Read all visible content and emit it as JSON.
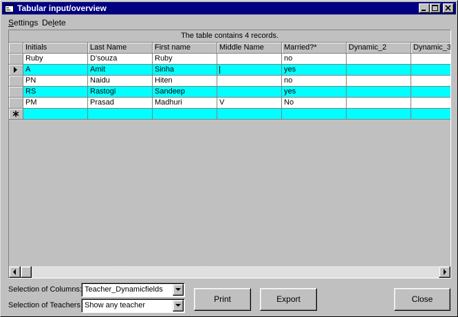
{
  "window": {
    "title": "Tabular input/overview",
    "icons": {
      "app": "form-icon",
      "minimize": "minimize-icon",
      "maximize": "maximize-icon",
      "close": "close-icon"
    }
  },
  "menu": [
    {
      "label": "Settings",
      "mnemonic_index": 0
    },
    {
      "label": "Delete",
      "mnemonic_index": 2
    }
  ],
  "grid": {
    "caption": "The table contains 4 records.",
    "columns": [
      "Initials",
      "Last Name",
      "First name",
      "Middle Name",
      "Married?*",
      "Dynamic_2",
      "Dynamic_3"
    ],
    "rows": [
      {
        "cells": [
          "Ruby",
          "D'souza",
          "Ruby",
          "",
          "no",
          "",
          ""
        ],
        "indicator": ""
      },
      {
        "cells": [
          "A",
          "Amit",
          "Sinha",
          "",
          "yes",
          "",
          ""
        ],
        "indicator": "current-row-arrow-icon"
      },
      {
        "cells": [
          "PN",
          "Naidu",
          "Hiten",
          "",
          "no",
          "",
          ""
        ],
        "indicator": ""
      },
      {
        "cells": [
          "RS",
          "Rastogi",
          "Sandeep",
          "",
          "yes",
          "",
          ""
        ],
        "indicator": ""
      },
      {
        "cells": [
          "PM",
          "Prasad",
          "Madhuri",
          "V",
          "No",
          "",
          ""
        ],
        "indicator": ""
      }
    ],
    "new_row_indicator": "new-record-asterisk-icon",
    "row_colors": {
      "even": "#ffffff",
      "odd": "#00ffff"
    }
  },
  "controls": {
    "columns_label": "Selection of Columns:",
    "columns_value": "Teacher_Dynamicfields",
    "teachers_label": "Selection of Teachers:",
    "teachers_value": "Show any teacher",
    "print_label": "Print",
    "export_label": "Export",
    "close_label": "Close"
  },
  "colors": {
    "title_bar": "#000080",
    "face": "#c0c0c0",
    "highlight_row": "#00ffff"
  }
}
